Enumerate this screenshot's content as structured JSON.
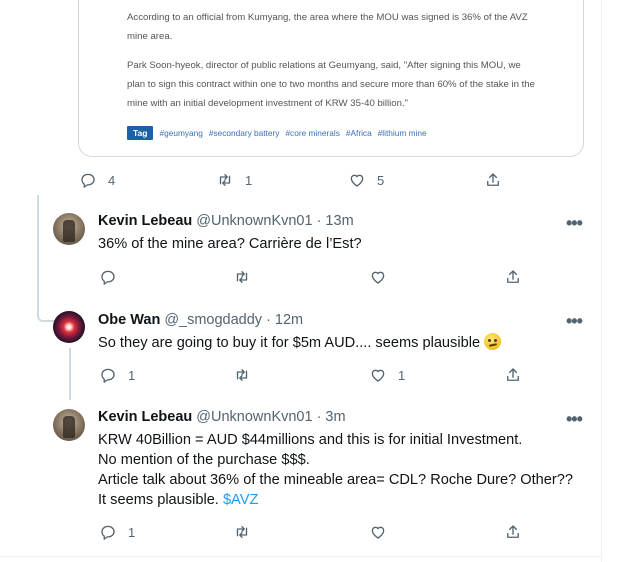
{
  "article": {
    "para1": "According to an official from Kumyang, the area where the MOU was signed is 36% of the AVZ mine area.",
    "para2": "Park Soon-hyeok, director of public relations at Geumyang, said, \"After signing this MOU, we plan to sign this contract within one to two months and secure more than 60% of the stake in the mine with an initial development investment of KRW 35-40 billion.\"",
    "tag_label": "Tag",
    "tags": [
      "#geumyang",
      "#secondary battery",
      "#core minerals",
      "#Africa",
      "#lithium mine"
    ]
  },
  "main_tweet_actions": {
    "replies": "4",
    "retweets": "1",
    "likes": "5"
  },
  "replies": [
    {
      "name": "Kevin Lebeau",
      "handle": "@UnknownKvn01",
      "time": "· 13m",
      "text": "36% of the mine area? Carrière de l’Est?",
      "reply_count": "",
      "retweet_count": "",
      "like_count": ""
    },
    {
      "name": "Obe Wan",
      "handle": "@_smogdaddy",
      "time": "· 12m",
      "text": "So they are going to buy it for $5m AUD.... seems plausible",
      "emoji": "confused-face-emoji",
      "reply_count": "1",
      "retweet_count": "",
      "like_count": "1"
    },
    {
      "name": "Kevin Lebeau",
      "handle": "@UnknownKvn01",
      "time": "· 3m",
      "lines": [
        "KRW 40Billion = AUD $44millions and this is for initial Investment.",
        "No mention of the purchase $$$.",
        "Article talk about 36% of the mineable area= CDL? Roche Dure? Other??",
        "It seems plausible."
      ],
      "cashtag": "$AVZ",
      "reply_count": "1",
      "retweet_count": "",
      "like_count": ""
    }
  ],
  "more_glyph": "•••",
  "colors": {
    "accent": "#1d9bf0",
    "muted": "#536471",
    "tag_bg": "#1d5fa8"
  }
}
